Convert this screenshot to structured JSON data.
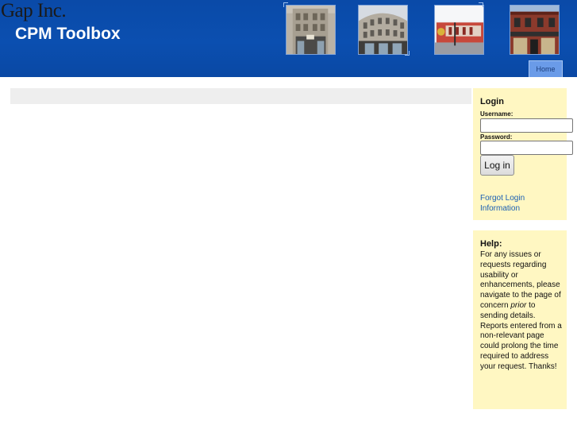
{
  "header": {
    "company_logo": "Gap Inc.",
    "app_title": "CPM Toolbox",
    "background_color": "#0b4fb0"
  },
  "nav": {
    "home_tab": "Home"
  },
  "login": {
    "title": "Login",
    "username_label": "Username:",
    "username_value": "",
    "password_label": "Password:",
    "password_value": "",
    "login_button": "Log in",
    "forgot_link": "Forgot Login Information",
    "panel_color": "#fff7c2"
  },
  "help": {
    "title": "Help:",
    "text_before": "For any issues or requests regarding usability or enhancements, please navigate to the page of concern ",
    "text_emphasis": "prior",
    "text_after": " to sending details. Reports entered from a non-relevant page could prolong the time required to address your request. Thanks!"
  },
  "icons": [
    "storefront-photo-1",
    "storefront-photo-2",
    "storefront-photo-3",
    "storefront-photo-4"
  ]
}
